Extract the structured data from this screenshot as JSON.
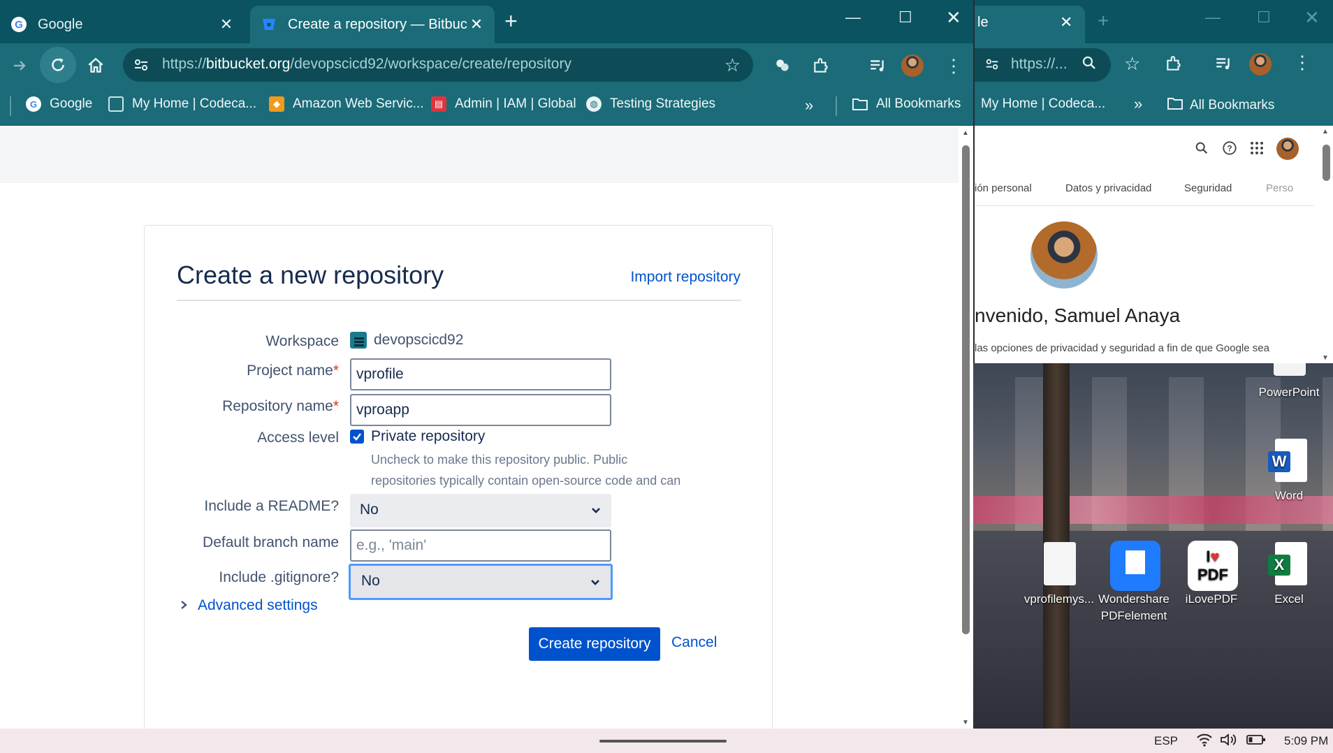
{
  "left_browser": {
    "tabs": [
      {
        "title": "Google",
        "icon": "google-icon"
      },
      {
        "title": "Create a repository — Bitbucket",
        "icon": "bitbucket-icon"
      }
    ],
    "url_host": "bitbucket.org",
    "url_prefix": "https://",
    "url_path": "/devopscicd92/workspace/create/repository",
    "bookmarks": [
      {
        "label": "Google",
        "icon": "google-icon"
      },
      {
        "label": "My Home | Codeca...",
        "icon": "codecademy-icon"
      },
      {
        "label": "Amazon Web Servic...",
        "icon": "aws-icon"
      },
      {
        "label": "Admin | IAM | Global",
        "icon": "iam-icon"
      },
      {
        "label": "Testing Strategies",
        "icon": "globe-icon"
      }
    ],
    "all_bookmarks": "All Bookmarks"
  },
  "form": {
    "title": "Create a new repository",
    "import_link": "Import repository",
    "workspace_label": "Workspace",
    "workspace_value": "devopscicd92",
    "project_label": "Project name",
    "project_value": "vprofile",
    "repo_label": "Repository name",
    "repo_value": "vproapp",
    "required_mark": "*",
    "access_label": "Access level",
    "private_label": "Private repository",
    "private_checked": true,
    "hint": "Uncheck to make this repository public. Public repositories typically contain open-source code and can be viewed by anyone.",
    "readme_label": "Include a README?",
    "readme_value": "No",
    "branch_label": "Default branch name",
    "branch_placeholder": "e.g., 'main'",
    "gitignore_label": "Include .gitignore?",
    "gitignore_value": "No",
    "advanced": "Advanced settings",
    "create_button": "Create repository",
    "cancel_button": "Cancel"
  },
  "right_browser": {
    "tab_fragment": "le",
    "url": "https://...",
    "bookmark": "My Home | Codeca...",
    "all_bookmarks": "All Bookmarks",
    "nav_tabs": [
      "ión personal",
      "Datos y privacidad",
      "Seguridad",
      "Perso"
    ],
    "welcome": "nvenido, Samuel Anaya",
    "desc": "las opciones de privacidad y seguridad a fin de que Google sea"
  },
  "desktop": {
    "icons": [
      {
        "label": "PowerPoint"
      },
      {
        "label": "Word"
      },
      {
        "label": "vprofilemys..."
      },
      {
        "label": "Wondershare PDFelement"
      },
      {
        "label": "iLovePDF"
      },
      {
        "label": "Excel"
      }
    ]
  },
  "taskbar": {
    "lang": "ESP",
    "time": "5:09 PM"
  },
  "colors": {
    "titlebar": "#0b5360",
    "toolbar": "#1b6b78",
    "primary": "#0052cc"
  }
}
